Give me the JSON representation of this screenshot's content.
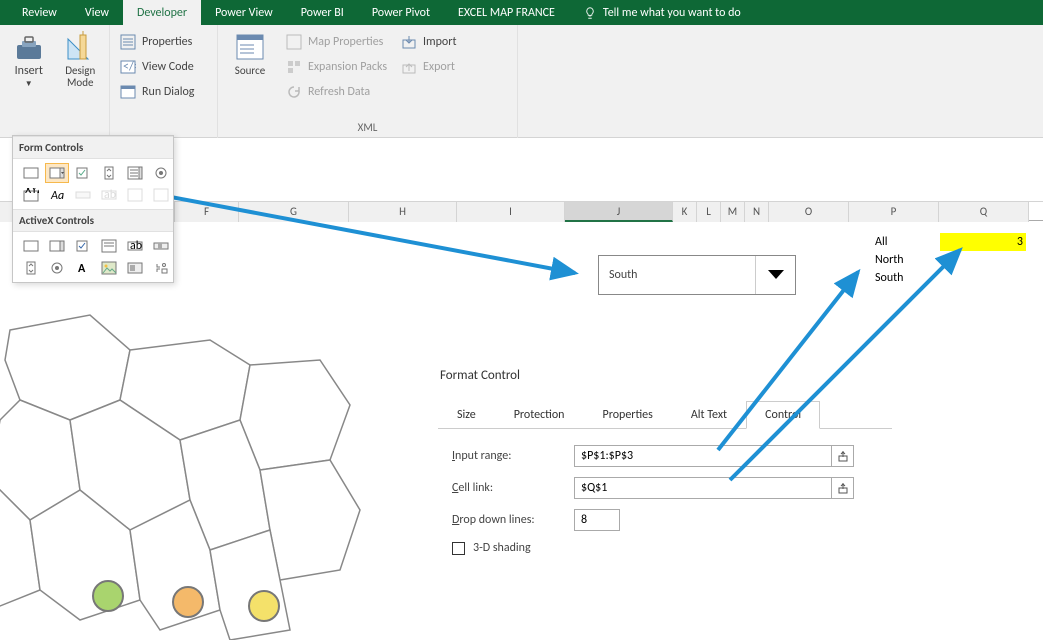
{
  "tabs": {
    "review": "Review",
    "view": "View",
    "developer": "Developer",
    "powerview": "Power View",
    "powerbi": "Power BI",
    "powerpivot": "Power Pivot",
    "mapfrance": "EXCEL MAP FRANCE",
    "tellme": "Tell me what you want to do"
  },
  "ribbon": {
    "insert": "Insert",
    "design_mode": "Design\nMode",
    "properties": "Properties",
    "view_code": "View Code",
    "run_dialog": "Run Dialog",
    "source": "Source",
    "map_properties": "Map Properties",
    "expansion_packs": "Expansion Packs",
    "refresh_data": "Refresh Data",
    "import": "Import",
    "export": "Export",
    "group_xml": "XML"
  },
  "dropdown": {
    "form_controls": "Form Controls",
    "activex_controls": "ActiveX Controls"
  },
  "columns": [
    "F",
    "G",
    "H",
    "I",
    "J",
    "K",
    "L",
    "M",
    "N",
    "O",
    "P",
    "Q"
  ],
  "cells": {
    "p1": "All",
    "p2": "North",
    "p3": "South",
    "q1": "3"
  },
  "combo": {
    "value": "South"
  },
  "dialog": {
    "title": "Format Control",
    "tabs": {
      "size": "Size",
      "protection": "Protection",
      "properties": "Properties",
      "alttext": "Alt Text",
      "control": "Control"
    },
    "input_range_label_pre": "I",
    "input_range_label": "nput range:",
    "cell_link_label_pre": "C",
    "cell_link_label": "ell link:",
    "drop_down_label_pre": "D",
    "drop_down_label": "rop down lines:",
    "shading_pre": "3",
    "shading": "-D shading",
    "input_range": "$P$1:$P$3",
    "cell_link": "$Q$1",
    "drop_down_lines": "8"
  }
}
